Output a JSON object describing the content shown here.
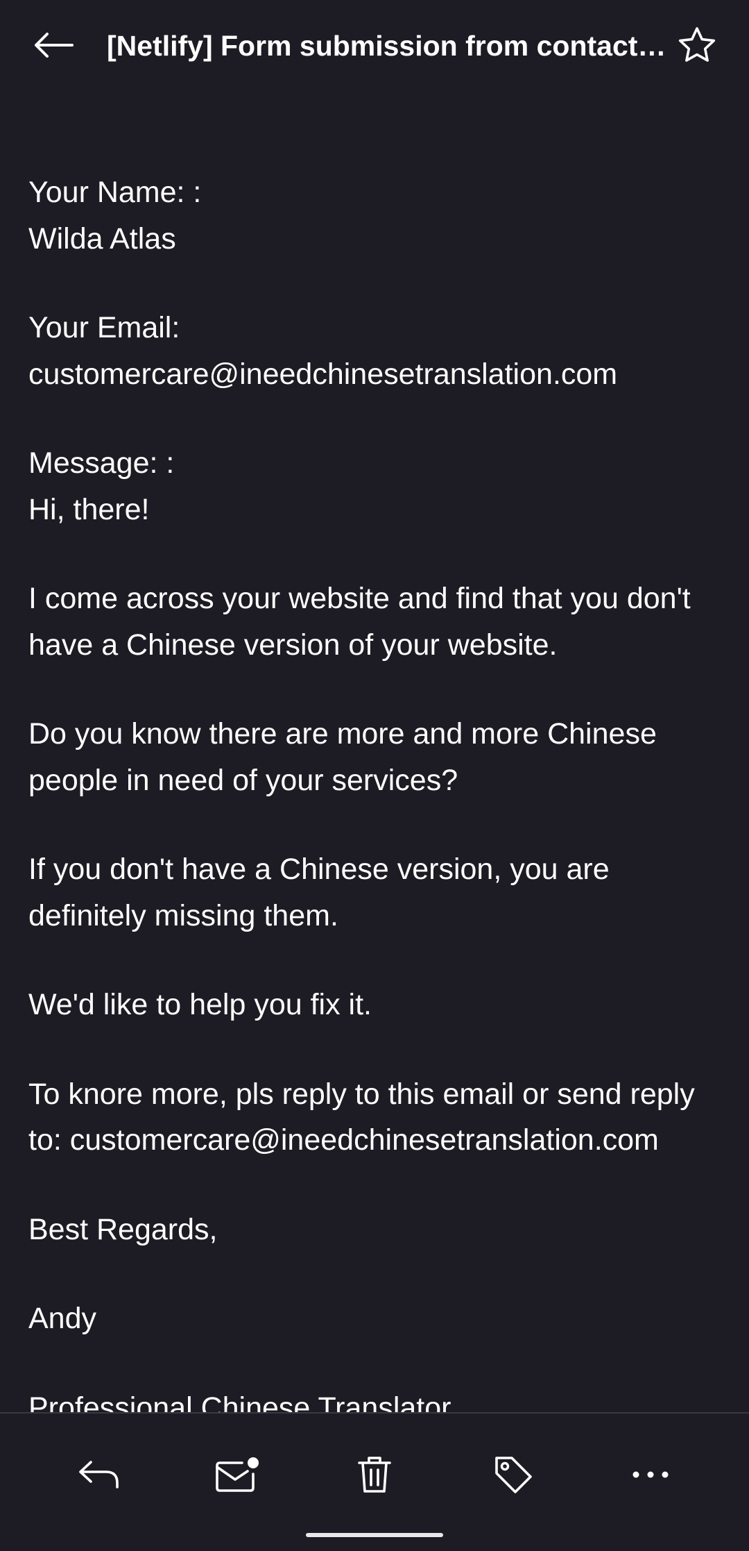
{
  "header": {
    "title": "[Netlify] Form submission from contact-page",
    "back_icon": "arrow-left-icon",
    "star_icon": "star-outline-icon"
  },
  "email": {
    "name_label": "Your Name: :",
    "name_value": "Wilda Atlas",
    "email_label": "Your Email:",
    "email_value": "customercare@ineedchinesetranslation.com",
    "message_label": "Message: :",
    "greeting": "Hi, there!",
    "p1_line1": "I come across your website and find that you don't",
    "p1_line2": "have a Chinese version of your website.",
    "p2_line1": "Do you know there are more and more Chinese",
    "p2_line2": "people in need of your services?",
    "p3_line1": "If you don't have a Chinese version, you are",
    "p3_line2": "definitely missing them.",
    "p4": "We'd like to help you fix it.",
    "p5_line1": "To knore more, pls reply to this email or send reply",
    "p5_line2": "to: customercare@ineedchinesetranslation.com",
    "closing": "Best Regards,",
    "signature": "Andy",
    "signature_title": "Professional Chinese Translator"
  },
  "bottom_bar": {
    "actions": [
      {
        "icon": "reply-icon"
      },
      {
        "icon": "mark-unread-icon"
      },
      {
        "icon": "trash-icon"
      },
      {
        "icon": "tag-icon"
      },
      {
        "icon": "more-icon"
      }
    ]
  },
  "colors": {
    "background": "#1d1c24",
    "text": "#ffffff",
    "divider": "#3a3942"
  }
}
